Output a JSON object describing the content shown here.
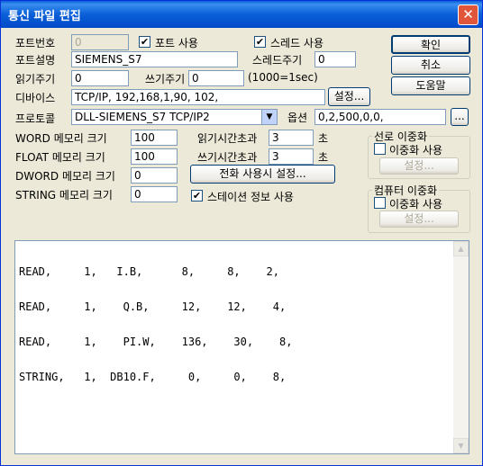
{
  "window": {
    "title": "통신 파일 편집",
    "close_glyph": "✕"
  },
  "labels": {
    "port_no": "포트번호",
    "port_use": "포트 사용",
    "thread_use": "스레드 사용",
    "port_desc": "포트설명",
    "thread_cycle": "스레드주기",
    "read_cycle": "읽기주기",
    "write_cycle": "쓰기주기",
    "unit_note": "(1000=1sec)",
    "device": "디바이스",
    "protocol": "프로토콜",
    "option": "옵션",
    "word_mem": "WORD 메모리 크기",
    "float_mem": "FLOAT 메모리 크기",
    "dword_mem": "DWORD 메모리 크기",
    "string_mem": "STRING 메모리 크기",
    "read_timeout": "읽기시간초과",
    "write_timeout": "쓰기시간초과",
    "sec": "초",
    "station_info": "스테이션 정보 사용"
  },
  "values": {
    "port_no": "0",
    "port_desc": "SIEMENS_S7",
    "thread_cycle": "0",
    "read_cycle": "0",
    "write_cycle": "0",
    "device": "TCP/IP, 192,168,1,90, 102,",
    "protocol": "DLL-SIEMENS_S7 TCP/IP2",
    "option": "0,2,500,0,0,",
    "word_mem": "100",
    "float_mem": "100",
    "dword_mem": "0",
    "string_mem": "0",
    "read_timeout": "3",
    "write_timeout": "3"
  },
  "checks": {
    "port_use": true,
    "thread_use": true,
    "station_info": true,
    "line_dual": false,
    "pc_dual": false
  },
  "buttons": {
    "ok": "확인",
    "cancel": "취소",
    "help": "도움말",
    "device_settings": "설정...",
    "option_more": "...",
    "phone_settings": "전화 사용시 설정...",
    "line_settings": "설정...",
    "pc_settings": "설정..."
  },
  "groups": {
    "line_dual": {
      "title": "선로 이중화",
      "check_label": "이중화 사용"
    },
    "pc_dual": {
      "title": "컴퓨터 이중화",
      "check_label": "이중화 사용"
    }
  },
  "editor_lines": [
    "READ,     1,   I.B,      8,     8,    2,",
    "READ,     1,    Q.B,     12,    12,    4,",
    "READ,     1,    PI.W,    136,    30,    8,",
    "STRING,   1,  DB10.F,     0,     0,    8,"
  ]
}
